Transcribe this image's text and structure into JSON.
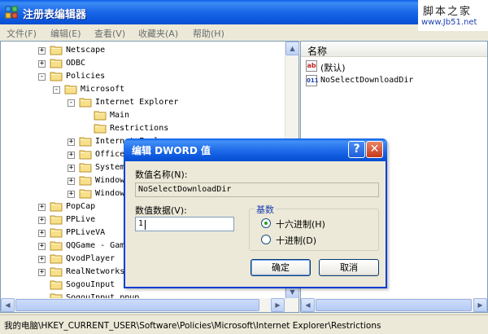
{
  "window": {
    "title": "注册表编辑器"
  },
  "watermark": {
    "text": "脚本之家",
    "url": "www.Jb51.net"
  },
  "menu": [
    {
      "label": "文件(F)"
    },
    {
      "label": "编辑(E)"
    },
    {
      "label": "查看(V)"
    },
    {
      "label": "收藏夹(A)"
    },
    {
      "label": "帮助(H)"
    }
  ],
  "tree": [
    {
      "label": "Netscape",
      "level": 0,
      "expander": "+"
    },
    {
      "label": "ODBC",
      "level": 0,
      "expander": "+"
    },
    {
      "label": "Policies",
      "level": 0,
      "expander": "-"
    },
    {
      "label": "Microsoft",
      "level": 1,
      "expander": "-"
    },
    {
      "label": "Internet Explorer",
      "level": 2,
      "expander": "-"
    },
    {
      "label": "Main",
      "level": 3,
      "expander": ""
    },
    {
      "label": "Restrictions",
      "level": 3,
      "expander": "",
      "selected": true
    },
    {
      "label": "Internet Explorer",
      "level": 2,
      "expander": "+"
    },
    {
      "label": "Office",
      "level": 2,
      "expander": "+"
    },
    {
      "label": "SystemCertificates",
      "level": 2,
      "expander": "+"
    },
    {
      "label": "Windows",
      "level": 2,
      "expander": "+"
    },
    {
      "label": "Windows NT",
      "level": 2,
      "expander": "+"
    },
    {
      "label": "PopCap",
      "level": 0,
      "expander": "+"
    },
    {
      "label": "PPLive",
      "level": 0,
      "expander": "+"
    },
    {
      "label": "PPLiveVA",
      "level": 0,
      "expander": "+"
    },
    {
      "label": "QQGame - Game",
      "level": 0,
      "expander": "+"
    },
    {
      "label": "QvodPlayer",
      "level": 0,
      "expander": "+"
    },
    {
      "label": "RealNetworks",
      "level": 0,
      "expander": "+"
    },
    {
      "label": "SogouInput",
      "level": 0,
      "expander": ""
    },
    {
      "label": "SogouInput.ppup",
      "level": 0,
      "expander": ""
    }
  ],
  "values_pane": {
    "column_header": "名称",
    "rows": [
      {
        "icon": "ab",
        "name": "(默认)"
      },
      {
        "icon": "011",
        "name": "NoSelectDownloadDir"
      }
    ]
  },
  "status": {
    "path": "我的电脑\\HKEY_CURRENT_USER\\Software\\Policies\\Microsoft\\Internet Explorer\\Restrictions"
  },
  "dialog": {
    "title": "编辑 DWORD 值",
    "name_label": "数值名称(N):",
    "name_value": "NoSelectDownloadDir",
    "data_label": "数值数据(V):",
    "data_value": "1",
    "base_title": "基数",
    "radio_hex": "十六进制(H)",
    "radio_dec": "十进制(D)",
    "base_selected": "hex",
    "ok_label": "确定",
    "cancel_label": "取消",
    "help_glyph": "?",
    "close_glyph": "✕"
  }
}
